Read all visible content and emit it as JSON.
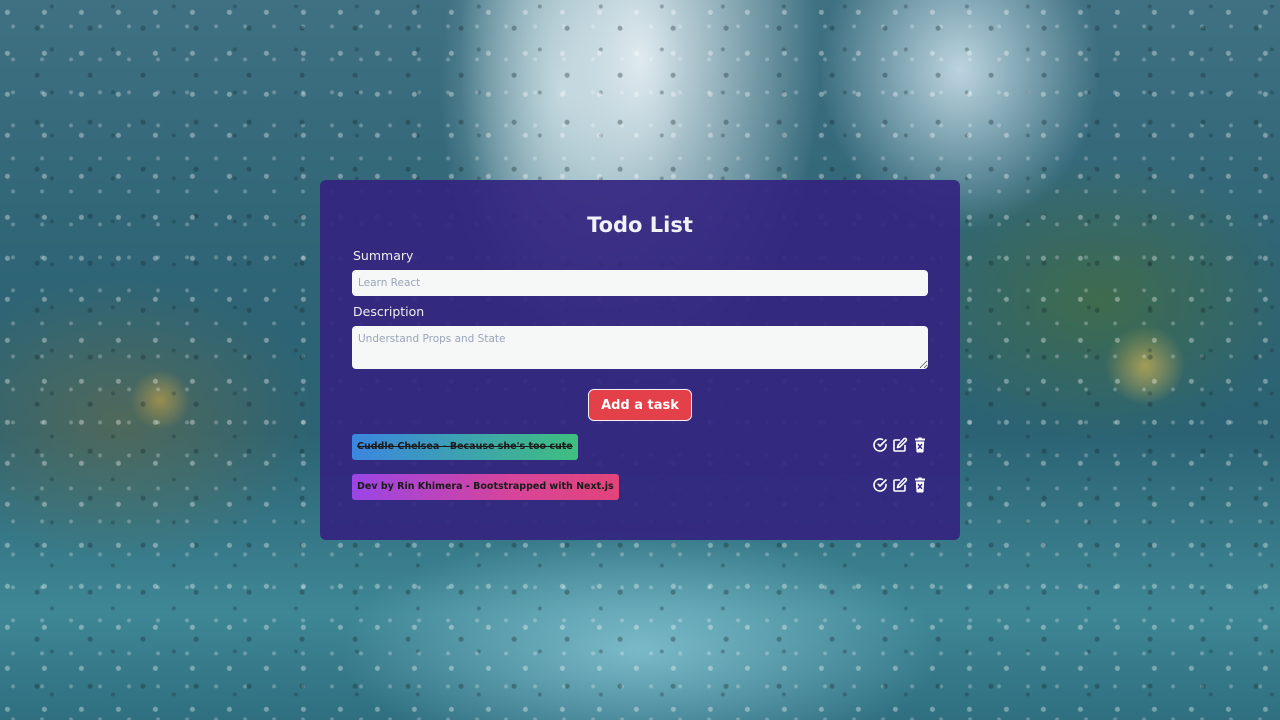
{
  "app": {
    "title": "Todo List"
  },
  "form": {
    "summary_label": "Summary",
    "summary_placeholder": "Learn React",
    "summary_value": "",
    "description_label": "Description",
    "description_placeholder": "Understand Props and State",
    "description_value": "",
    "add_button_label": "Add a task"
  },
  "todos": [
    {
      "text": "Cuddle Chelsea - Because she's too cute",
      "completed": true,
      "gradient": [
        "#3b86e0",
        "#3fbf7f"
      ]
    },
    {
      "text": "Dev by Rin Khimera - Bootstrapped with Next.js",
      "completed": false,
      "gradient": [
        "#9a45e6",
        "#e2447a"
      ]
    }
  ],
  "icons": {
    "complete": "check-circle-icon",
    "edit": "edit-icon",
    "delete": "trash-icon"
  },
  "colors": {
    "card_background": "#34268a",
    "accent_button": "#e3404a",
    "input_background": "#f6f7f7"
  }
}
